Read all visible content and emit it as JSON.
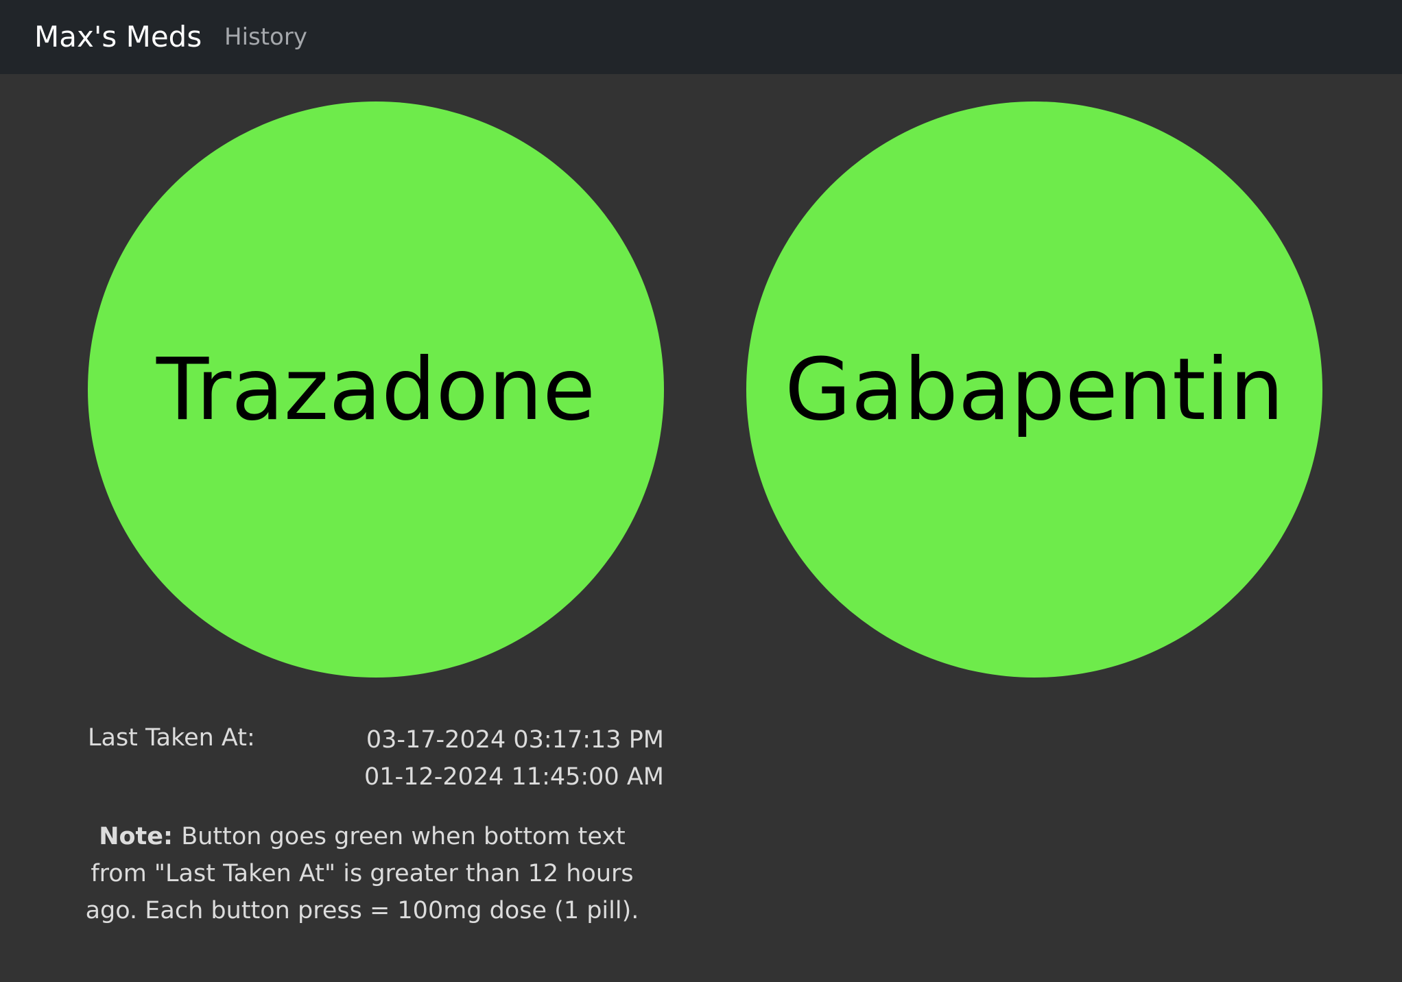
{
  "navbar": {
    "brand": "Max's Meds",
    "links": [
      "History"
    ]
  },
  "medications": [
    {
      "name": "Trazadone",
      "color": "#6eeb4b"
    },
    {
      "name": "Gabapentin",
      "color": "#6eeb4b"
    }
  ],
  "last_taken": {
    "label": "Last Taken At:",
    "times": [
      "03-17-2024 03:17:13 PM",
      "01-12-2024 11:45:00 AM"
    ]
  },
  "note": {
    "label": "Note:",
    "text": "Button goes green when bottom text from \"Last Taken At\" is greater than 12 hours ago. Each button press = 100mg dose (1 pill)."
  },
  "colors": {
    "background": "#333333",
    "navbar": "#212529",
    "nav_link": "#a5a8ac",
    "text": "#dcdcdc",
    "ready_green": "#6eeb4b"
  }
}
